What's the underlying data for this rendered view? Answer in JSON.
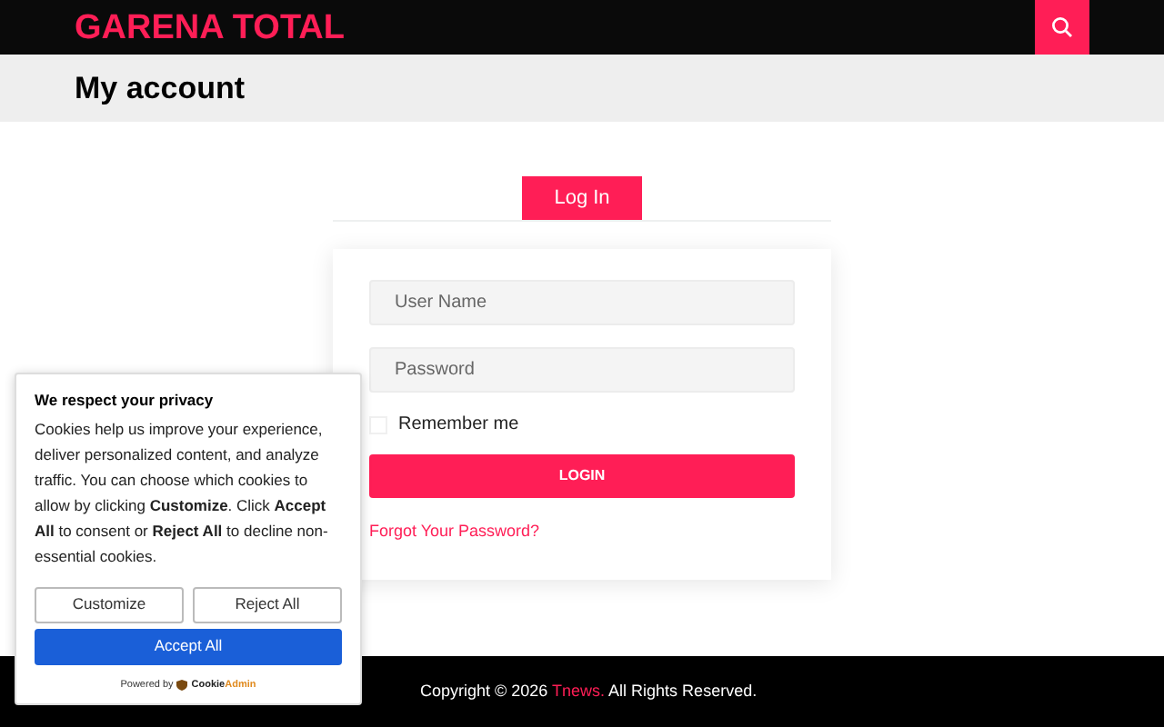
{
  "header": {
    "logo": "GARENA TOTAL"
  },
  "page_title": "My account",
  "tabs": [
    {
      "label": "Log In",
      "selected": true
    }
  ],
  "login_form": {
    "username": {
      "placeholder": "User Name"
    },
    "password": {
      "placeholder": "Password"
    },
    "remember": {
      "label": "Remember me",
      "checked": false
    },
    "submit": "LOGIN",
    "forgot": "Forgot Your Password?"
  },
  "footer": {
    "prefix": "Copyright © 2026",
    "link": "Tnews.",
    "suffix": "All Rights Reserved."
  },
  "cookie_banner": {
    "title": "We respect your privacy",
    "text": "Cookies help us improve your experience, deliver personalized content, and analyze traffic. You can choose which cookies to allow by clicking **Customize**. Click **Accept All** to consent or **Reject All** to decline non-essential cookies.",
    "buttons": [
      {
        "label": "Customize",
        "kind": "outline"
      },
      {
        "label": "Reject All",
        "kind": "outline"
      },
      {
        "label": "Accept All",
        "kind": "primary"
      }
    ],
    "powered_by": "Powered by",
    "brand_first": "Cookie",
    "brand_second": "Admin"
  }
}
